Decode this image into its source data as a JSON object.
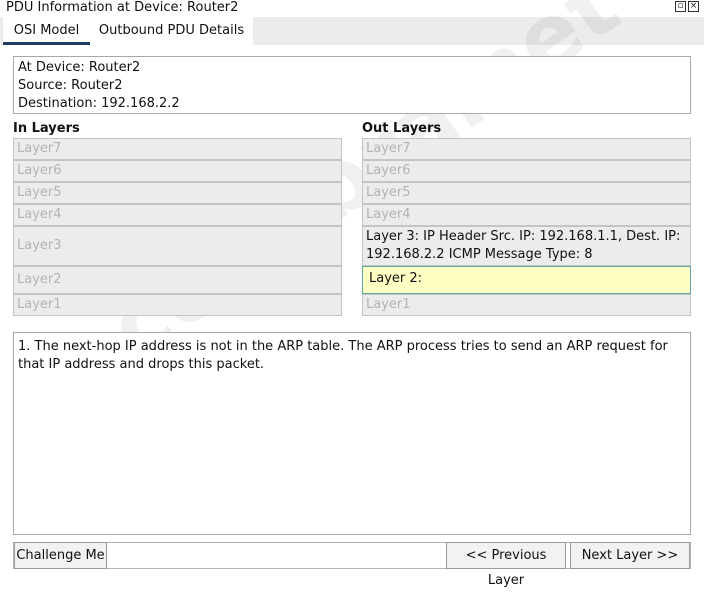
{
  "window": {
    "title": "PDU Information at Device: Router2"
  },
  "tabs": [
    {
      "label": "OSI Model",
      "active": true
    },
    {
      "label": "Outbound PDU Details",
      "active": false
    }
  ],
  "info": {
    "device": "At Device: Router2",
    "source": "Source: Router2",
    "destination": "Destination: 192.168.2.2"
  },
  "in_layers": {
    "heading": "In Layers",
    "items": [
      "Layer7",
      "Layer6",
      "Layer5",
      "Layer4",
      "Layer3",
      "Layer2",
      "Layer1"
    ]
  },
  "out_layers": {
    "heading": "Out Layers",
    "items": [
      "Layer7",
      "Layer6",
      "Layer5",
      "Layer4",
      "Layer 3: IP Header Src. IP: 192.168.1.1, Dest. IP: 192.168.2.2 ICMP Message Type: 8",
      "Layer 2:",
      "Layer1"
    ]
  },
  "description": "1. The next-hop IP address is not in the ARP table. The ARP process tries to send an ARP request for that IP address and drops this packet.",
  "buttons": {
    "challenge": "Challenge Me",
    "previous": "<< Previous Layer",
    "next": "Next Layer >>"
  },
  "watermark": "codebrainet"
}
